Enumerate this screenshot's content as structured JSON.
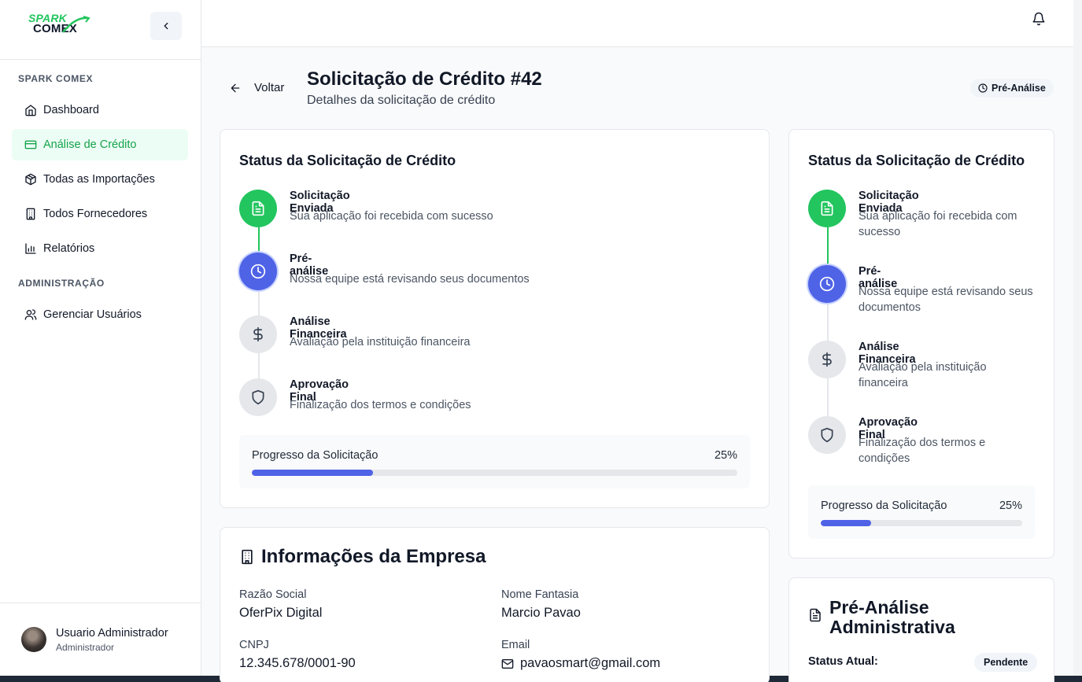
{
  "logo": {
    "line1": "SPARK",
    "line2": "COMEX"
  },
  "sidebar": {
    "section1": "SPARK COMEX",
    "items": [
      {
        "label": "Dashboard",
        "icon": "home-icon"
      },
      {
        "label": "Análise de Crédito",
        "icon": "credit-card-icon",
        "active": true
      },
      {
        "label": "Todas as Importações",
        "icon": "package-icon"
      },
      {
        "label": "Todos Fornecedores",
        "icon": "building-icon"
      },
      {
        "label": "Relatórios",
        "icon": "bar-chart-icon"
      }
    ],
    "section2": "ADMINISTRAÇÃO",
    "admin_items": [
      {
        "label": "Gerenciar Usuários",
        "icon": "users-icon"
      }
    ],
    "user": {
      "name": "Usuario Administrador",
      "role": "Administrador"
    }
  },
  "header": {
    "back_label": "Voltar",
    "title": "Solicitação de Crédito #42",
    "subtitle": "Detalhes da solicitação de crédito",
    "status_badge": "Pré-Análise"
  },
  "status_card": {
    "title": "Status da Solicitação de Crédito",
    "steps": [
      {
        "title": "Solicitação Enviada",
        "desc": "Sua aplicação foi recebida com sucesso",
        "state": "done"
      },
      {
        "title": "Pré-análise",
        "desc": "Nossa equipe está revisando seus documentos",
        "state": "current"
      },
      {
        "title": "Análise Financeira",
        "desc": "Avaliação pela instituição financeira",
        "state": "pending"
      },
      {
        "title": "Aprovação Final",
        "desc": "Finalização dos termos e condições",
        "state": "pending"
      }
    ],
    "progress_label": "Progresso da Solicitação",
    "progress_text": "25%",
    "progress_value": 0.25
  },
  "company": {
    "title": "Informações da Empresa",
    "razao_label": "Razão Social",
    "razao_value": "OferPix Digital",
    "fantasia_label": "Nome Fantasia",
    "fantasia_value": "Marcio Pavao",
    "cnpj_label": "CNPJ",
    "cnpj_value": "12.345.678/0001-90",
    "email_label": "Email",
    "email_value": "pavaosmart@gmail.com"
  },
  "pre_analysis": {
    "title_line1": "Pré-Análise",
    "title_line2": "Administrativa",
    "status_label": "Status Atual:",
    "status_value": "Pendente"
  },
  "colors": {
    "accent_green": "#22c55e",
    "accent_blue": "#4f63e7",
    "pending_gray": "#e5e7eb"
  }
}
